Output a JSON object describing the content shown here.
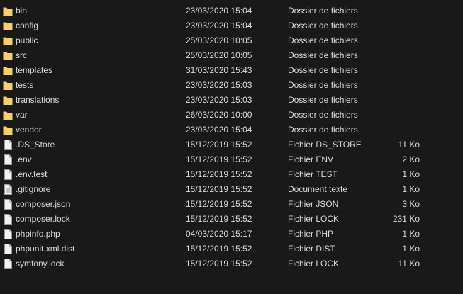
{
  "colors": {
    "background": "#191919",
    "text": "#dcdcdc",
    "folder": "#f5d06b",
    "file": "#f2f2f2"
  },
  "files": [
    {
      "name": "bin",
      "date": "23/03/2020 15:04",
      "type": "Dossier de fichiers",
      "size": "",
      "icon": "folder-icon"
    },
    {
      "name": "config",
      "date": "23/03/2020 15:04",
      "type": "Dossier de fichiers",
      "size": "",
      "icon": "folder-icon"
    },
    {
      "name": "public",
      "date": "25/03/2020 10:05",
      "type": "Dossier de fichiers",
      "size": "",
      "icon": "folder-icon"
    },
    {
      "name": "src",
      "date": "25/03/2020 10:05",
      "type": "Dossier de fichiers",
      "size": "",
      "icon": "folder-icon"
    },
    {
      "name": "templates",
      "date": "31/03/2020 15:43",
      "type": "Dossier de fichiers",
      "size": "",
      "icon": "folder-icon"
    },
    {
      "name": "tests",
      "date": "23/03/2020 15:03",
      "type": "Dossier de fichiers",
      "size": "",
      "icon": "folder-icon"
    },
    {
      "name": "translations",
      "date": "23/03/2020 15:03",
      "type": "Dossier de fichiers",
      "size": "",
      "icon": "folder-icon"
    },
    {
      "name": "var",
      "date": "26/03/2020 10:00",
      "type": "Dossier de fichiers",
      "size": "",
      "icon": "folder-icon"
    },
    {
      "name": "vendor",
      "date": "23/03/2020 15:04",
      "type": "Dossier de fichiers",
      "size": "",
      "icon": "folder-icon"
    },
    {
      "name": ".DS_Store",
      "date": "15/12/2019 15:52",
      "type": "Fichier DS_STORE",
      "size": "11 Ko",
      "icon": "file-icon"
    },
    {
      "name": ".env",
      "date": "15/12/2019 15:52",
      "type": "Fichier ENV",
      "size": "2 Ko",
      "icon": "file-icon"
    },
    {
      "name": ".env.test",
      "date": "15/12/2019 15:52",
      "type": "Fichier TEST",
      "size": "1 Ko",
      "icon": "file-icon"
    },
    {
      "name": ".gitignore",
      "date": "15/12/2019 15:52",
      "type": "Document texte",
      "size": "1 Ko",
      "icon": "text-file-icon"
    },
    {
      "name": "composer.json",
      "date": "15/12/2019 15:52",
      "type": "Fichier JSON",
      "size": "3 Ko",
      "icon": "file-icon"
    },
    {
      "name": "composer.lock",
      "date": "15/12/2019 15:52",
      "type": "Fichier LOCK",
      "size": "231 Ko",
      "icon": "file-icon"
    },
    {
      "name": "phpinfo.php",
      "date": "04/03/2020 15:17",
      "type": "Fichier PHP",
      "size": "1 Ko",
      "icon": "file-icon"
    },
    {
      "name": "phpunit.xml.dist",
      "date": "15/12/2019 15:52",
      "type": "Fichier DIST",
      "size": "1 Ko",
      "icon": "file-icon"
    },
    {
      "name": "symfony.lock",
      "date": "15/12/2019 15:52",
      "type": "Fichier LOCK",
      "size": "11 Ko",
      "icon": "file-icon"
    }
  ]
}
